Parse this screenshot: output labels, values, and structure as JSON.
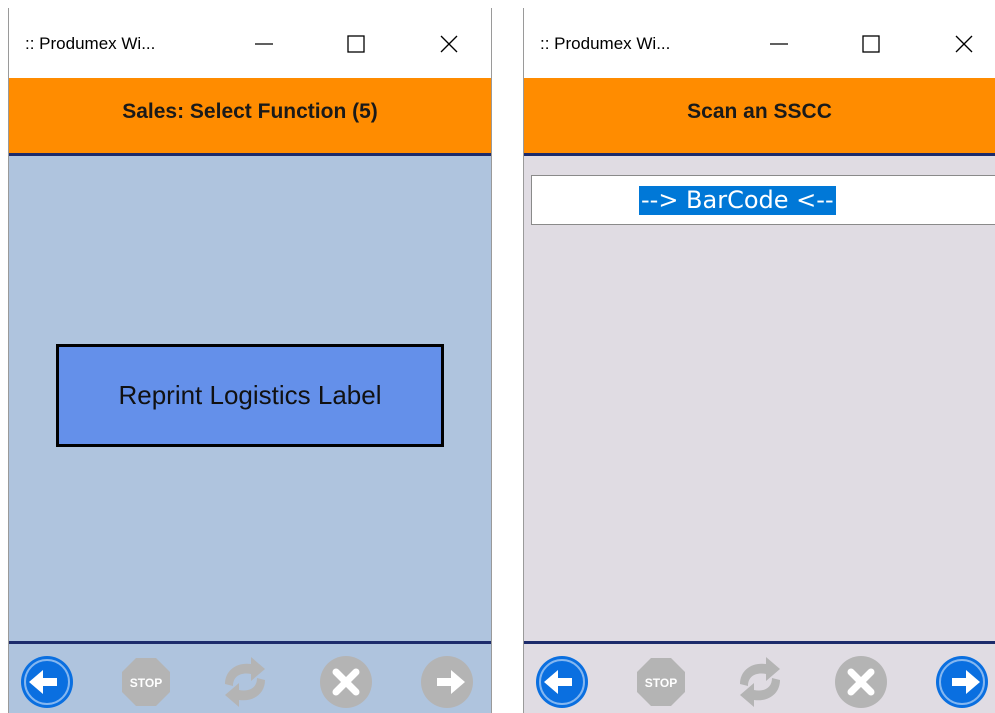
{
  "left_window": {
    "title": ":: Produmex Wi...",
    "header": "Sales: Select Function (5)",
    "function_button": "Reprint Logistics Label",
    "footer_buttons": [
      "back-icon",
      "stop-icon",
      "refresh-icon",
      "cancel-icon",
      "next-icon"
    ]
  },
  "right_window": {
    "title": ":: Produmex Wi...",
    "header": "Scan an SSCC",
    "barcode_field_value": "--> BarCode <--",
    "footer_buttons": [
      "back-icon",
      "stop-icon",
      "refresh-icon",
      "cancel-icon",
      "next-icon"
    ]
  },
  "icons": {
    "stop_label": "STOP"
  },
  "colors": {
    "header_orange": "#ff8c00",
    "left_body": "#afc4de",
    "right_body": "#e0dce3",
    "function_button": "#6490ea",
    "active_nav_blue": "#0a6fe0",
    "disabled_gray": "#b4b4b4",
    "selection_blue": "#0078d7"
  }
}
